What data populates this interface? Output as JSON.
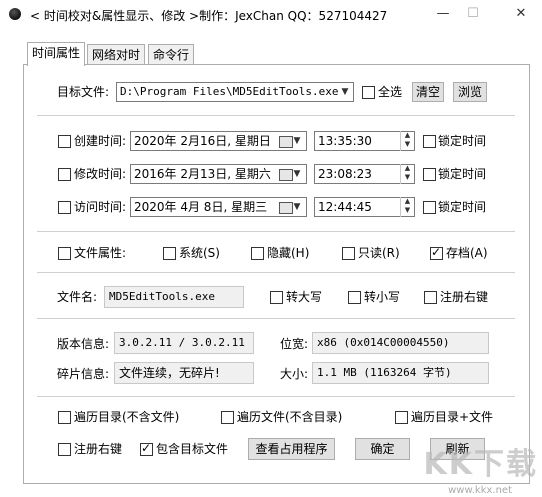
{
  "window": {
    "title": "< 时间校对&属性显示、修改 >制作：JexChan  QQ：527104427",
    "minimize": "—",
    "maximize": "☐",
    "close": "✕"
  },
  "tabs": [
    "时间属性",
    "网络对时",
    "命令行"
  ],
  "target": {
    "label": "目标文件:",
    "value": "D:\\Program Files\\MD5EditTools.exe",
    "select_all": "全选",
    "clear": "清空",
    "browse": "浏览"
  },
  "times": [
    {
      "label": "创建时间:",
      "date": "2020年 2月16日, 星期日",
      "time": "13:35:30",
      "lock": "锁定时间"
    },
    {
      "label": "修改时间:",
      "date": "2016年 2月13日, 星期六",
      "time": "23:08:23",
      "lock": "锁定时间"
    },
    {
      "label": "访问时间:",
      "date": "2020年 4月 8日, 星期三",
      "time": "12:44:45",
      "lock": "锁定时间"
    }
  ],
  "attributes": {
    "label": "文件属性:",
    "system": "系统(S)",
    "hidden": "隐藏(H)",
    "readonly": "只读(R)",
    "archive": "存档(A)"
  },
  "filename": {
    "label": "文件名:",
    "value": "MD5EditTools.exe",
    "upper": "转大写",
    "lower": "转小写",
    "register": "注册右键"
  },
  "info": {
    "version_label": "版本信息:",
    "version_value": "3.0.2.11 / 3.0.2.11",
    "bitness_label": "位宽:",
    "bitness_value": "x86 (0x014C00004550)",
    "frag_label": "碎片信息:",
    "frag_value": "文件连续，无碎片!",
    "size_label": "大小:",
    "size_value": "1.1 MB (1163264 字节)"
  },
  "bottom": {
    "traverse_dir": "遍历目录(不含文件)",
    "traverse_file": "遍历文件(不含目录)",
    "traverse_both": "遍历目录+文件",
    "register": "注册右键",
    "include_target": "包含目标文件",
    "view_usage": "查看占用程序",
    "ok": "确定",
    "refresh": "刷新"
  },
  "watermark": {
    "brand": "KK下载",
    "url": "www.kkx.net"
  },
  "colors": {
    "check": "#000000",
    "border": "#adadad",
    "button": "#e1e1e1"
  }
}
